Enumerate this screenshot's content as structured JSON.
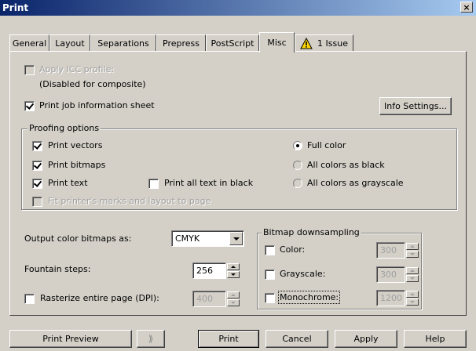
{
  "window": {
    "title": "Print",
    "close_glyph": "×"
  },
  "tabs": [
    {
      "label": "General",
      "active": false
    },
    {
      "label": "Layout",
      "active": false
    },
    {
      "label": "Separations",
      "active": false
    },
    {
      "label": "Prepress",
      "active": false
    },
    {
      "label": "PostScript",
      "active": false
    },
    {
      "label": "Misc",
      "active": true
    },
    {
      "label": "1 Issue",
      "active": false,
      "icon": "warning-icon"
    }
  ],
  "misc": {
    "apply_icc": {
      "label": "Apply ICC profile:",
      "checked": false,
      "enabled": false
    },
    "icc_note": "(Disabled for composite)",
    "print_job_info": {
      "label": "Print job information sheet",
      "checked": true
    },
    "info_settings_button": "Info Settings...",
    "proofing": {
      "title": "Proofing options",
      "print_vectors": {
        "label": "Print vectors",
        "checked": true
      },
      "print_bitmaps": {
        "label": "Print bitmaps",
        "checked": true
      },
      "print_text": {
        "label": "Print text",
        "checked": true
      },
      "print_text_black": {
        "label": "Print all text in black",
        "checked": false
      },
      "fit_marks": {
        "label": "Fit printer's marks and layout to page",
        "checked": false,
        "enabled": false
      },
      "full_color": {
        "label": "Full color",
        "selected": true
      },
      "all_black": {
        "label": "All colors as black",
        "selected": false
      },
      "all_grayscale": {
        "label": "All colors as grayscale",
        "selected": false
      }
    },
    "output_color": {
      "label": "Output color bitmaps as:",
      "value": "CMYK"
    },
    "fountain_steps": {
      "label": "Fountain steps:",
      "value": "256"
    },
    "rasterize": {
      "label": "Rasterize entire page (DPI):",
      "checked": false,
      "value": "400"
    },
    "bitmap_downsampling": {
      "title": "Bitmap downsampling",
      "color": {
        "label": "Color:",
        "checked": false,
        "value": "300"
      },
      "grayscale": {
        "label": "Grayscale:",
        "checked": false,
        "value": "300"
      },
      "monochrome": {
        "label": "Monochrome:",
        "checked": false,
        "value": "1200"
      }
    }
  },
  "buttons": {
    "print_preview": "Print Preview",
    "preview_toggle_glyph": "⟫",
    "print": "Print",
    "cancel": "Cancel",
    "apply": "Apply",
    "help": "Help"
  },
  "colors": {
    "title_start": "#0a246a",
    "title_end": "#a6caf0",
    "face": "#d4d0c8",
    "warning": "#ffd700"
  }
}
